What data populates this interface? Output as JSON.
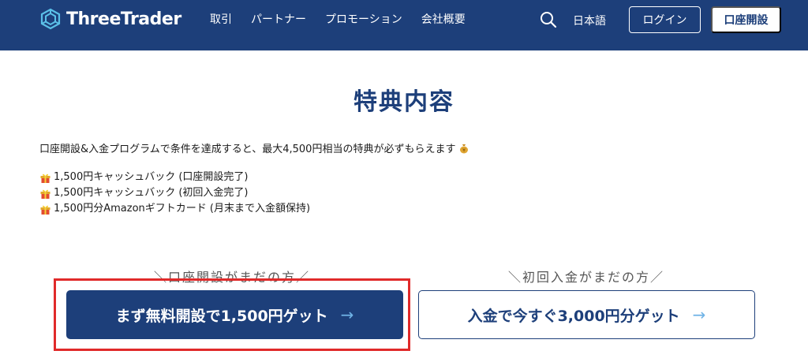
{
  "header": {
    "brand": "ThreeTrader",
    "nav": [
      "取引",
      "パートナー",
      "プロモーション",
      "会社概要"
    ],
    "language": "日本語",
    "login_label": "ログイン",
    "open_account_label": "口座開設"
  },
  "main": {
    "title": "特典内容",
    "intro": "口座開設&入金プログラムで条件を達成すると、最大4,500円相当の特典が必ずもらえます",
    "benefits": [
      "1,500円キャッシュバック (口座開設完了)",
      "1,500円キャッシュバック (初回入金完了)",
      "1,500円分Amazonギフトカード (月末まで入金額保持)"
    ],
    "cta_left": {
      "caption": "＼口座開設がまだの方／",
      "label": "まず無料開設で1,500円ゲット",
      "arrow": "→"
    },
    "cta_right": {
      "caption": "＼初回入金がまだの方／",
      "label": "入金で今すぐ3,000円分ゲット",
      "arrow": "→"
    }
  },
  "colors": {
    "brand_navy": "#1d3f7a",
    "highlight_red": "#e02a2a",
    "arrow_blue": "#6fb3e6"
  },
  "icons": {
    "logo": "threetrader-logo-icon",
    "search": "search-icon",
    "gift": "gift-icon",
    "money": "money-bag-icon",
    "arrow": "arrow-right-icon"
  }
}
